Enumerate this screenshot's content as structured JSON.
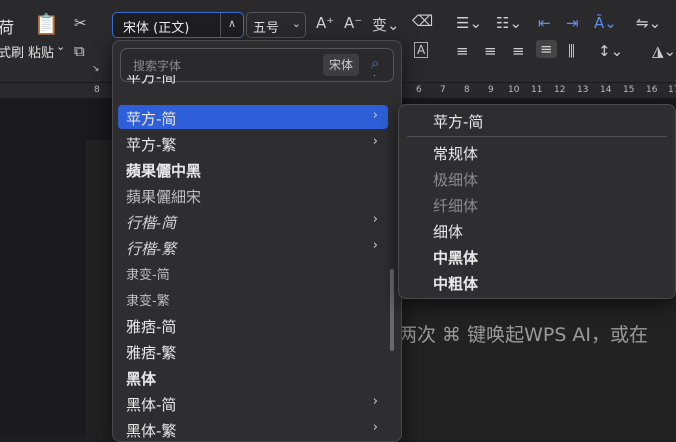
{
  "ribbon": {
    "clipboard_label_partial": "式刷",
    "paste_label": "粘贴",
    "paste_chevron": "⌄",
    "font_name": "宋体 (正文)",
    "font_size": "五号",
    "left_fragment": "荷"
  },
  "ruler": {
    "numbers": [
      "8",
      "6",
      "7",
      "8",
      "9",
      "10",
      "11",
      "12",
      "13",
      "14",
      "15",
      "16",
      "17"
    ]
  },
  "font_dropdown": {
    "search_placeholder": "搜索字体",
    "search_tag": "宋体",
    "items": [
      {
        "name": "苹方-简",
        "has_submenu": true
      },
      {
        "name": "苹方-简",
        "has_submenu": true
      },
      {
        "name": "苹方-繁",
        "has_submenu": true
      },
      {
        "name": "蘋果儷中黑",
        "has_submenu": false
      },
      {
        "name": "蘋果儷細宋",
        "has_submenu": false
      },
      {
        "name": "行楷-简",
        "has_submenu": true
      },
      {
        "name": "行楷-繁",
        "has_submenu": true
      },
      {
        "name": "隶变-简",
        "has_submenu": false
      },
      {
        "name": "隶变-繁",
        "has_submenu": false
      },
      {
        "name": "雅痞-简",
        "has_submenu": false
      },
      {
        "name": "雅痞-繁",
        "has_submenu": false
      },
      {
        "name": "黑体",
        "has_submenu": false
      },
      {
        "name": "黑体-简",
        "has_submenu": true
      },
      {
        "name": "黑体-繁",
        "has_submenu": true
      }
    ]
  },
  "submenu": {
    "title": "苹方-简",
    "weights": [
      {
        "name": "常规体",
        "state": "normal"
      },
      {
        "name": "极细体",
        "state": "dim"
      },
      {
        "name": "纤细体",
        "state": "dim"
      },
      {
        "name": "细体",
        "state": "normal"
      },
      {
        "name": "中黑体",
        "state": "bold"
      },
      {
        "name": "中粗体",
        "state": "bold"
      }
    ]
  },
  "document": {
    "text_fragment": "两次 ⌘ 键唤起WPS AI，或在"
  },
  "colors": {
    "accent": "#2f5fd8",
    "search_icon": "#3b7ff0"
  }
}
